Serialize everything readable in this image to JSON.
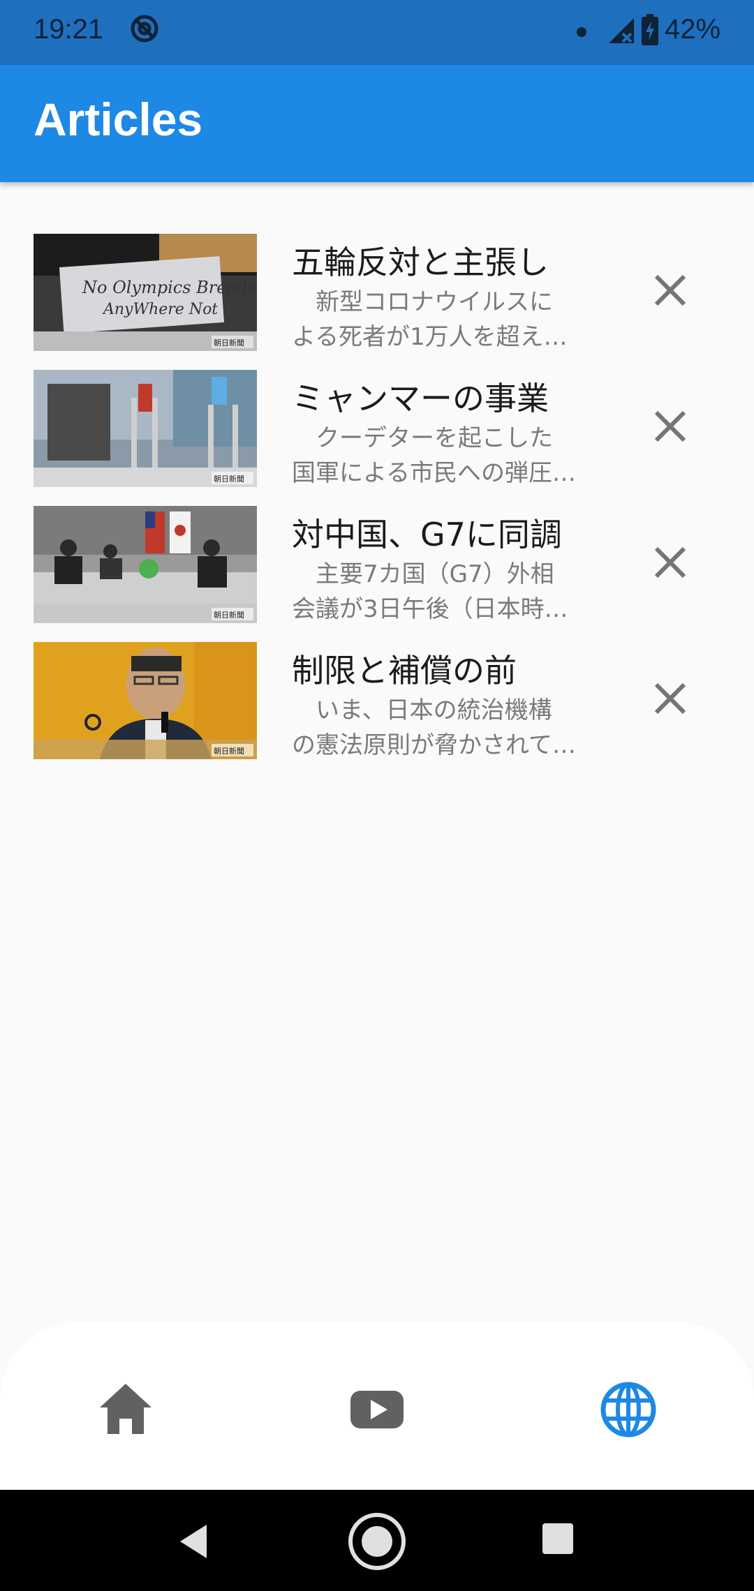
{
  "status_bar": {
    "time": "19:21",
    "battery_percent": "42%"
  },
  "app_bar": {
    "title": "Articles"
  },
  "articles": [
    {
      "title": "五輪反対と主張し",
      "summary_line1": "　新型コロナウイルスに",
      "summary_line2": "よる死者が1万人を超え…",
      "thumbnail_watermark": "朝日新聞"
    },
    {
      "title": "ミャンマーの事業",
      "summary_line1": "　クーデターを起こした",
      "summary_line2": "国軍による市民への弾圧…",
      "thumbnail_watermark": "朝日新聞"
    },
    {
      "title": "対中国、G7に同調",
      "summary_line1": "　主要7カ国（G7）外相",
      "summary_line2": "会議が3日午後（日本時…",
      "thumbnail_watermark": "朝日新聞"
    },
    {
      "title": "制限と補償の前",
      "summary_line1": "　いま、日本の統治機構",
      "summary_line2": "の憲法原則が脅かされて…",
      "thumbnail_watermark": "朝日新聞"
    }
  ],
  "bottom_nav": {
    "items": [
      {
        "icon": "home-icon",
        "active": false
      },
      {
        "icon": "youtube-icon",
        "active": false
      },
      {
        "icon": "globe-icon",
        "active": true
      }
    ]
  },
  "colors": {
    "app_bar": "#1e88e5",
    "status_bar": "#1f6fbf",
    "nav_active": "#1e88e5",
    "nav_inactive": "#616161"
  }
}
